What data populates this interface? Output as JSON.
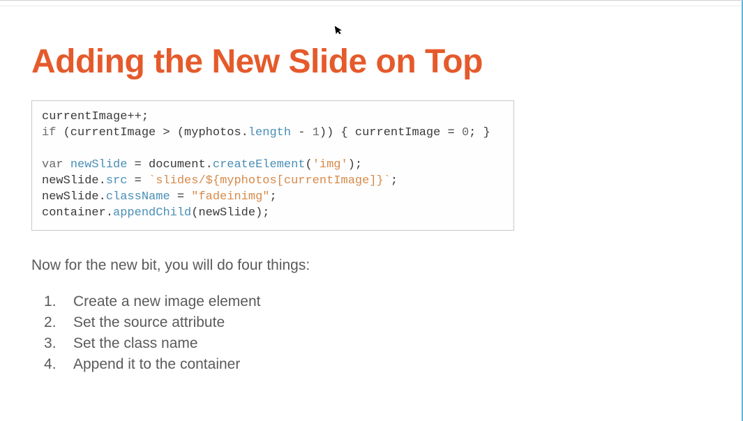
{
  "slide": {
    "title": "Adding the New Slide on Top",
    "code": {
      "tokens": [
        {
          "t": "currentImage++;\n",
          "c": "tok-default"
        },
        {
          "t": "if",
          "c": "tok-keyword"
        },
        {
          "t": " (currentImage > (myphotos.",
          "c": "tok-default"
        },
        {
          "t": "length",
          "c": "tok-prop"
        },
        {
          "t": " - ",
          "c": "tok-default"
        },
        {
          "t": "1",
          "c": "tok-num"
        },
        {
          "t": ")) { currentImage = ",
          "c": "tok-default"
        },
        {
          "t": "0",
          "c": "tok-num"
        },
        {
          "t": "; }\n\n",
          "c": "tok-default"
        },
        {
          "t": "var",
          "c": "tok-keyword"
        },
        {
          "t": " ",
          "c": "tok-default"
        },
        {
          "t": "newSlide",
          "c": "tok-var"
        },
        {
          "t": " = ",
          "c": "tok-default"
        },
        {
          "t": "document",
          "c": "tok-default"
        },
        {
          "t": ".",
          "c": "tok-default"
        },
        {
          "t": "createElement",
          "c": "tok-prop"
        },
        {
          "t": "(",
          "c": "tok-default"
        },
        {
          "t": "'img'",
          "c": "tok-string"
        },
        {
          "t": ");\n",
          "c": "tok-default"
        },
        {
          "t": "newSlide.",
          "c": "tok-default"
        },
        {
          "t": "src",
          "c": "tok-prop"
        },
        {
          "t": " = ",
          "c": "tok-default"
        },
        {
          "t": "`slides/${myphotos[currentImage]}`",
          "c": "tok-string"
        },
        {
          "t": ";\n",
          "c": "tok-default"
        },
        {
          "t": "newSlide.",
          "c": "tok-default"
        },
        {
          "t": "className",
          "c": "tok-prop"
        },
        {
          "t": " = ",
          "c": "tok-default"
        },
        {
          "t": "\"fadeinimg\"",
          "c": "tok-string"
        },
        {
          "t": ";\n",
          "c": "tok-default"
        },
        {
          "t": "container.",
          "c": "tok-default"
        },
        {
          "t": "appendChild",
          "c": "tok-prop"
        },
        {
          "t": "(newSlide);",
          "c": "tok-default"
        }
      ]
    },
    "intro_text": "Now for the new bit, you will do four things:",
    "steps": [
      "Create a new image element",
      "Set the source attribute",
      "Set the class name",
      "Append it to the container"
    ]
  }
}
